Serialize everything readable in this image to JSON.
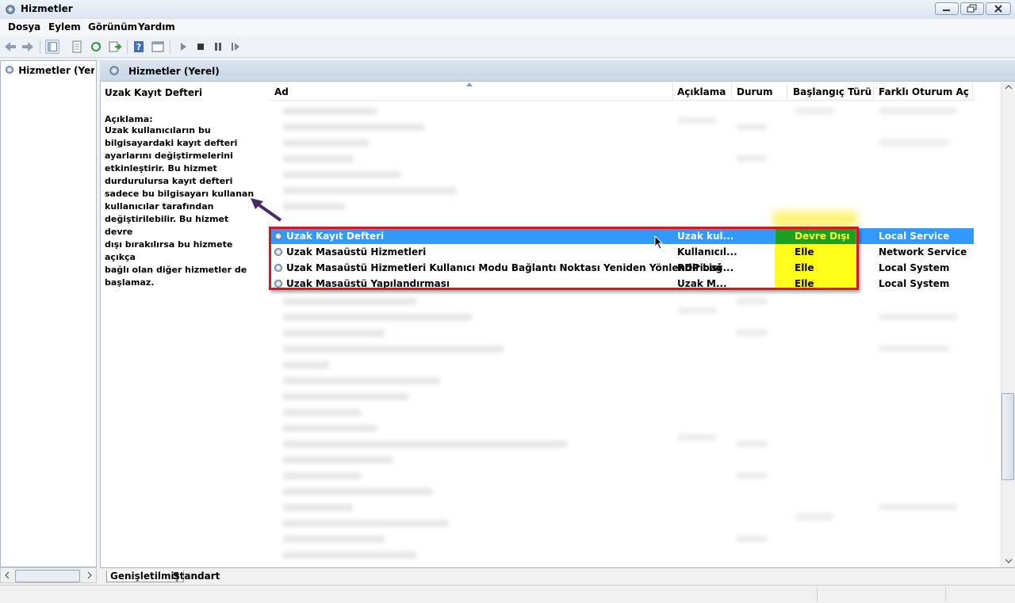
{
  "window": {
    "title": "Hizmetler"
  },
  "menu": [
    "Dosya",
    "Eylem",
    "Görünüm",
    "Yardım"
  ],
  "tree": {
    "root_label": "Hizmetler (Yerel)"
  },
  "main": {
    "header_title": "Hizmetler (Yerel)"
  },
  "description": {
    "service_name": "Uzak Kayıt Defteri",
    "label": "Açıklama:",
    "lines": [
      "Uzak kullanıcıların bu",
      "bilgisayardaki kayıt defteri",
      "ayarlarını değiştirmelerini",
      "etkinleştirir. Bu hizmet",
      "durdurulursa kayıt defteri",
      "sadece bu bilgisayarı kullanan",
      "kullanıcılar tarafından",
      "değiştirilebilir. Bu hizmet devre",
      "dışı bırakılırsa bu hizmete açıkça",
      "bağlı olan diğer hizmetler de",
      "başlamaz."
    ]
  },
  "columns": {
    "name": "Ad",
    "description": "Açıklama",
    "status": "Durum",
    "startup": "Başlangıç Türü",
    "logon": "Farklı Oturum Aç"
  },
  "services": [
    {
      "name": "Uzak Kayıt Defteri",
      "description": "Uzak kul...",
      "status": "",
      "startup": "Devre Dışı",
      "logon": "Local Service",
      "selected": true
    },
    {
      "name": "Uzak Masaüstü Hizmetleri",
      "description": "Kullanıcıl...",
      "status": "",
      "startup": "Elle",
      "logon": "Network Service",
      "selected": false
    },
    {
      "name": "Uzak Masaüstü Hizmetleri Kullanıcı Modu Bağlantı Noktası Yeniden Yönlendiricisi",
      "description": "RDP bağ...",
      "status": "",
      "startup": "Elle",
      "logon": "Local System",
      "selected": false
    },
    {
      "name": "Uzak Masaüstü Yapılandırması",
      "description": "Uzak M...",
      "status": "",
      "startup": "Elle",
      "logon": "Local System",
      "selected": false
    }
  ],
  "tabs": {
    "extended": "Genişletilmiş",
    "standard": "Standart"
  },
  "colors": {
    "selection": "#3399ff",
    "highlight_border": "#d01820",
    "startup_highlight": "#ffff1a",
    "disabled_badge": "#1f9f1f"
  }
}
